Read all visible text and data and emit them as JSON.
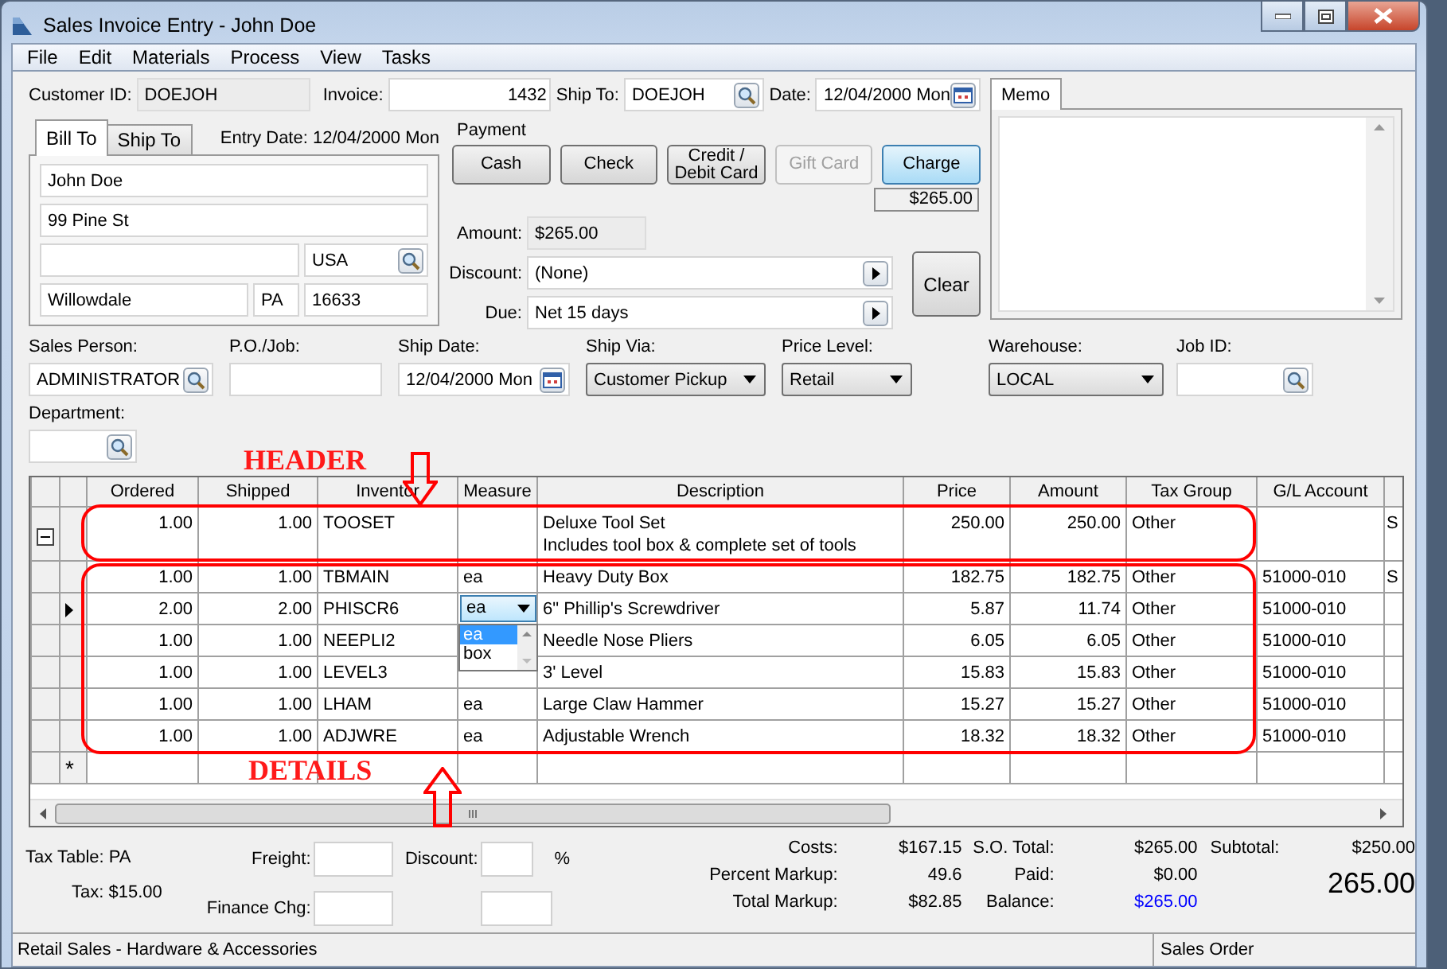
{
  "window": {
    "title": "Sales Invoice Entry - John Doe"
  },
  "menu": [
    "File",
    "Edit",
    "Materials",
    "Process",
    "View",
    "Tasks"
  ],
  "customer": {
    "customer_id_label": "Customer ID:",
    "customer_id": "DOEJOH",
    "invoice_label": "Invoice:",
    "invoice": "1432",
    "ship_to_label": "Ship To:",
    "ship_to": "DOEJOH",
    "date_label": "Date:",
    "date": "12/04/2000 Mon"
  },
  "address": {
    "tabs": [
      {
        "label": "Bill To",
        "selected": true
      },
      {
        "label": "Ship To",
        "selected": false
      }
    ],
    "entry_date_label": "Entry Date:",
    "entry_date": "12/04/2000 Mon",
    "name": "John Doe",
    "street": "99 Pine St",
    "country": "USA",
    "city": "Willowdale",
    "state": "PA",
    "zip": "16633"
  },
  "payment": {
    "title": "Payment",
    "methods": [
      {
        "label": "Cash",
        "selected": false,
        "disabled": false
      },
      {
        "label": "Check",
        "selected": false,
        "disabled": false
      },
      {
        "label": "Credit / Debit Card",
        "selected": false,
        "disabled": false
      },
      {
        "label": "Gift Card",
        "selected": false,
        "disabled": true
      },
      {
        "label": "Charge",
        "selected": true,
        "disabled": false
      }
    ],
    "charge_amount": "$265.00",
    "amount_label": "Amount:",
    "amount": "$265.00",
    "discount_label": "Discount:",
    "discount": "(None)",
    "due_label": "Due:",
    "due": "Net 15  days",
    "clear_button": "Clear"
  },
  "memo": {
    "tab": "Memo"
  },
  "fields": [
    {
      "label": "Sales Person:",
      "value": "ADMINISTRATOR",
      "kind": "lookup"
    },
    {
      "label": "P.O./Job:",
      "kind": "text"
    },
    {
      "label": "Ship Date:",
      "value": "12/04/2000 Mon",
      "kind": "date"
    },
    {
      "label": "Ship Via:",
      "value": "Customer Pickup",
      "kind": "dropdown"
    },
    {
      "label": "Price Level:",
      "value": "Retail",
      "kind": "dropdown"
    },
    {
      "label": "Warehouse:",
      "value": "LOCAL",
      "kind": "dropdown"
    },
    {
      "label": "Job ID:",
      "kind": "lookup"
    }
  ],
  "department": {
    "label": "Department:",
    "kind": "lookup"
  },
  "table": {
    "columns": [
      "Ordered",
      "Shipped",
      "Inventor",
      "Measure",
      "Description",
      "Price",
      "Amount",
      "Tax Group",
      "G/L Account"
    ],
    "rows": [
      {
        "kind": "header",
        "expanded": true,
        "current": false,
        "ordered": "1.00",
        "shipped": "1.00",
        "inventory": "TOOSET",
        "description": "Deluxe Tool Set",
        "note": "Includes tool box & complete set of tools",
        "price": "250.00",
        "amount": "250.00",
        "tax_group": "Other",
        "column_10": "S"
      },
      {
        "kind": "detail",
        "current": false,
        "ordered": "1.00",
        "shipped": "1.00",
        "inventory": "TBMAIN",
        "measure": "ea",
        "description": "Heavy Duty Box",
        "price": "182.75",
        "amount": "182.75",
        "tax_group": "Other",
        "gl_account": "51000-010",
        "column_10": "S"
      },
      {
        "kind": "detail",
        "current": true,
        "ordered": "2.00",
        "shipped": "2.00",
        "inventory": "PHISCR6",
        "measure": "ea",
        "dropdown": {
          "options": [
            {
              "label": "ea",
              "selected": true
            },
            {
              "label": "box",
              "selected": false
            }
          ]
        },
        "description": "6\" Phillip's Screwdriver",
        "price": "5.87",
        "amount": "11.74",
        "tax_group": "Other",
        "gl_account": "51000-010"
      },
      {
        "kind": "detail",
        "current": false,
        "ordered": "1.00",
        "shipped": "1.00",
        "inventory": "NEEPLI2",
        "description": "Needle Nose Pliers",
        "price": "6.05",
        "amount": "6.05",
        "tax_group": "Other",
        "gl_account": "51000-010"
      },
      {
        "kind": "detail",
        "current": false,
        "ordered": "1.00",
        "shipped": "1.00",
        "inventory": "LEVEL3",
        "description": "3' Level",
        "price": "15.83",
        "amount": "15.83",
        "tax_group": "Other",
        "gl_account": "51000-010"
      },
      {
        "kind": "detail",
        "current": false,
        "ordered": "1.00",
        "shipped": "1.00",
        "inventory": "LHAM",
        "measure": "ea",
        "description": "Large Claw Hammer",
        "price": "15.27",
        "amount": "15.27",
        "tax_group": "Other",
        "gl_account": "51000-010"
      },
      {
        "kind": "detail",
        "current": false,
        "ordered": "1.00",
        "shipped": "1.00",
        "inventory": "ADJWRE",
        "measure": "ea",
        "description": "Adjustable Wrench",
        "price": "18.32",
        "amount": "18.32",
        "tax_group": "Other",
        "gl_account": "51000-010"
      },
      {
        "kind": "new",
        "marker": "*"
      }
    ]
  },
  "annotations": [
    {
      "text": "HEADER"
    },
    {
      "text": "DETAILS"
    }
  ],
  "footer": {
    "tax_table": "Tax Table: PA",
    "tax": "Tax: $15.00",
    "freight_label": "Freight:",
    "finance_label": "Finance Chg:",
    "discount_label": "Discount:",
    "percent": "%",
    "costs": [
      {
        "label": "Costs:",
        "value": "$167.15"
      },
      {
        "label": "Percent Markup:",
        "value": "49.6"
      },
      {
        "label": "Total Markup:",
        "value": "$82.85"
      }
    ],
    "totals": [
      {
        "label": "S.O. Total:",
        "value": "$265.00",
        "highlight": false
      },
      {
        "label": "Paid:",
        "value": "$0.00",
        "highlight": false
      },
      {
        "label": "Balance:",
        "value": "$265.00",
        "highlight": true
      }
    ],
    "subtotal_label": "Subtotal:",
    "subtotal": "$250.00",
    "total": "265.00"
  },
  "status_bar": {
    "left": "Retail Sales - Hardware & Accessories",
    "right": "Sales Order"
  }
}
